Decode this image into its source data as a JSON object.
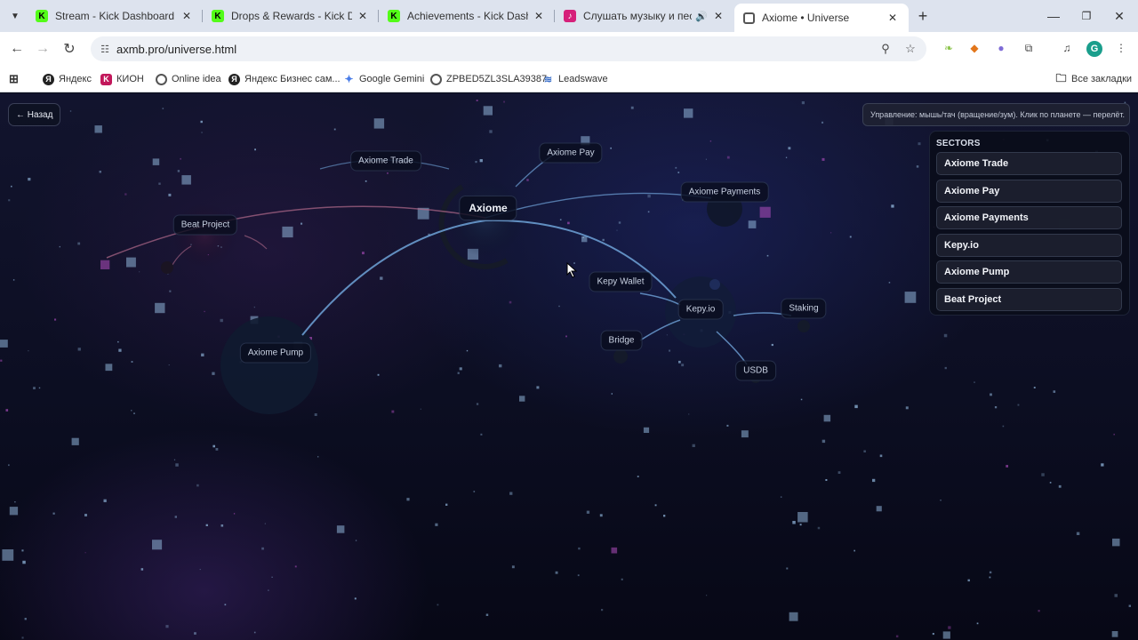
{
  "browser": {
    "tabs": [
      {
        "title": "Stream - Kick Dashboard",
        "favicon": "kick-logo",
        "active": false
      },
      {
        "title": "Drops & Rewards - Kick Dashboard",
        "favicon": "kick-logo",
        "active": false
      },
      {
        "title": "Achievements - Kick Dashboard",
        "favicon": "kick-logo",
        "active": false
      },
      {
        "title": "Слушать музыку и песни онлайн",
        "favicon": "music-logo",
        "active": false
      },
      {
        "title": "Axiome • Universe",
        "favicon": "globe-icon",
        "active": true
      }
    ],
    "url": "axmb.pro/universe.html",
    "bookmarks": [
      {
        "label": "Яндекс"
      },
      {
        "label": "КИОН"
      },
      {
        "label": "Online idea"
      },
      {
        "label": "Яндекс Бизнес сам..."
      },
      {
        "label": "Google Gemini"
      },
      {
        "label": "ZPBED5ZL3SLA39387"
      },
      {
        "label": "Leadswave"
      }
    ],
    "all_bookmarks": "Все закладки",
    "profile_initial": "G"
  },
  "page": {
    "back_label": "← Назад",
    "hint": "Управление: мышь/тач (вращение/зум). Клик по планете — перелёт.",
    "sectors_title": "SECTORS",
    "sectors": [
      {
        "label": "Axiome Trade"
      },
      {
        "label": "Axiome Pay"
      },
      {
        "label": "Axiome Payments"
      },
      {
        "label": "Kepy.io"
      },
      {
        "label": "Axiome Pump"
      },
      {
        "label": "Beat Project"
      }
    ],
    "planets": {
      "axiome": "Axiome",
      "trade": "Axiome Trade",
      "pay": "Axiome Pay",
      "payments": "Axiome Payments",
      "beat": "Beat Project",
      "pump": "Axiome Pump",
      "kepy_wallet": "Kepy Wallet",
      "kepy": "Kepy.io",
      "bridge": "Bridge",
      "staking": "Staking",
      "usdb": "USDB"
    }
  },
  "colors": {
    "accent_orbit": "#6fa3d8",
    "orbit_pink": "#b06a8a",
    "star_blue": "#8fb4d9",
    "star_purple": "#b04ec0"
  }
}
